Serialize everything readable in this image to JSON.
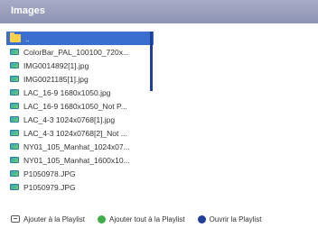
{
  "header": {
    "title": "Images"
  },
  "filelist": {
    "folder_row": {
      "icon": "folder-icon",
      "label": "..",
      "selected": true
    },
    "files": [
      "ColorBar_PAL_100100_720x...",
      "IMG0014892[1].jpg",
      "IMG0021185[1].jpg",
      "LAC_16-9 1680x1050.jpg",
      "LAC_16-9 1680x1050_Not P...",
      "LAC_4-3 1024x0768[1].jpg",
      "LAC_4-3 1024x0768[2]_Not ...",
      "NY01_105_Manhat_1024x07...",
      "NY01_105_Manhat_1600x10...",
      "P1050978.JPG",
      "P1050979.JPG"
    ]
  },
  "actions": {
    "add_to_playlist": "Ajouter à la Playlist",
    "add_all_to_playlist": "Ajouter tout à la Playlist",
    "open_playlist": "Ouvrir la Playlist"
  },
  "colors": {
    "header_bg": "#8d94b3",
    "selection": "#3a6fd0",
    "scroll_thumb": "#1f3f9a",
    "green_action": "#3fae49",
    "blue_action": "#1f3f9a"
  }
}
